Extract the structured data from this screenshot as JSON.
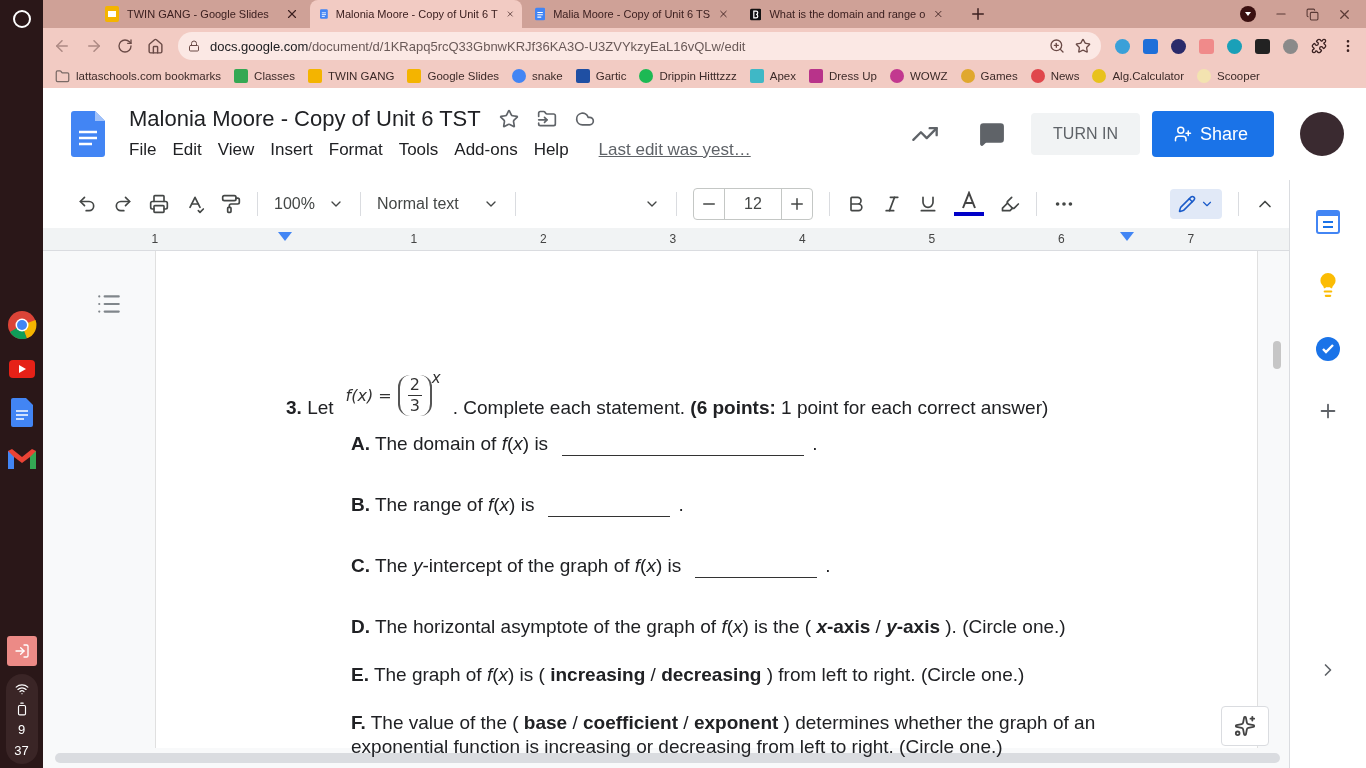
{
  "shelf": {
    "clock": {
      "hour": "9",
      "minute": "37"
    }
  },
  "browser": {
    "tabs": [
      {
        "title": "TWIN GANG - Google Slides",
        "kind": "slides",
        "selected": false
      },
      {
        "title": "Malonia Moore - Copy of Unit 6 T",
        "kind": "docs",
        "selected": true
      },
      {
        "title": "Malia Moore - Copy of Unit 6 TS",
        "kind": "docs",
        "selected": false
      },
      {
        "title": "What is the domain and range o",
        "kind": "letter-logo",
        "selected": false
      }
    ],
    "address": {
      "host": "docs.google.com",
      "path": "/document/d/1KRapq5rcQ33GbnwKRJf36KA3O-U3ZVYkzyEaL16vQLw/edit"
    },
    "bookmarks": [
      {
        "label": "lattaschools.com bookmarks",
        "kind": "folder",
        "color": "#7a6a66"
      },
      {
        "label": "Classes",
        "kind": "square",
        "color": "#34a853"
      },
      {
        "label": "TWIN GANG",
        "kind": "square",
        "color": "#f4b400"
      },
      {
        "label": "Google Slides",
        "kind": "square",
        "color": "#f4b400"
      },
      {
        "label": "snake",
        "kind": "round",
        "color": "#4285f4"
      },
      {
        "label": "Gartic",
        "kind": "square",
        "color": "#1f4fa3"
      },
      {
        "label": "Drippin Hitttzzz",
        "kind": "round",
        "color": "#1db954"
      },
      {
        "label": "Apex",
        "kind": "square",
        "color": "#3fb8c6"
      },
      {
        "label": "Dress Up",
        "kind": "square",
        "color": "#b8338a"
      },
      {
        "label": "WOWZ",
        "kind": "round",
        "color": "#c2388f"
      },
      {
        "label": "Games",
        "kind": "round",
        "color": "#e0a82e"
      },
      {
        "label": "News",
        "kind": "round",
        "color": "#e0474c"
      },
      {
        "label": "Alg.Calculator",
        "kind": "round",
        "color": "#e8c21c"
      },
      {
        "label": "Scooper",
        "kind": "round",
        "color": "#f3e3b0"
      }
    ]
  },
  "docs": {
    "title": "Malonia Moore - Copy of Unit 6 TST",
    "menu": [
      "File",
      "Edit",
      "View",
      "Insert",
      "Format",
      "Tools",
      "Add-ons",
      "Help"
    ],
    "last_edit": "Last edit was yest…",
    "turn_in": "TURN IN",
    "share": "Share",
    "toolbar": {
      "zoom": "100%",
      "style": "Normal text",
      "font_size": "12"
    },
    "ruler": [
      "1",
      "1",
      "2",
      "3",
      "4",
      "5",
      "6",
      "7"
    ]
  },
  "question": {
    "lead": "**3.** Let",
    "formula": {
      "lhs": "f(x) =",
      "numerator": "2",
      "denominator": "3",
      "exponent": "x"
    },
    "tail": ". Complete each statement. **(6 points:** 1 point for each correct answer)",
    "statements": [
      {
        "kind": "fill-in-long",
        "text": "**A.** The domain of *f*(*x*) is",
        "end": "."
      },
      {
        "kind": "fill-in",
        "text": "**B.** The range of *f*(*x*) is",
        "end": "."
      },
      {
        "kind": "fill-in",
        "text": "**C.** The *y*-intercept of the graph of *f*(*x*) is",
        "end": "."
      },
      {
        "kind": "choice",
        "text": "**D.** The horizontal asymptote of the graph of *f*(*x*) is the ( ***x*-axis** / ***y*-axis** ). (Circle one.)"
      },
      {
        "kind": "choice",
        "text": "**E.** The graph of *f*(*x*) is ( **increasing** / **decreasing** ) from left to right. (Circle one.)"
      },
      {
        "kind": "choice",
        "text": "**F.** The value of the ( **base** / **coefficient** / **exponent** ) determines whether the graph of an exponential function is increasing or decreasing from left to right. (Circle one.)"
      }
    ]
  }
}
